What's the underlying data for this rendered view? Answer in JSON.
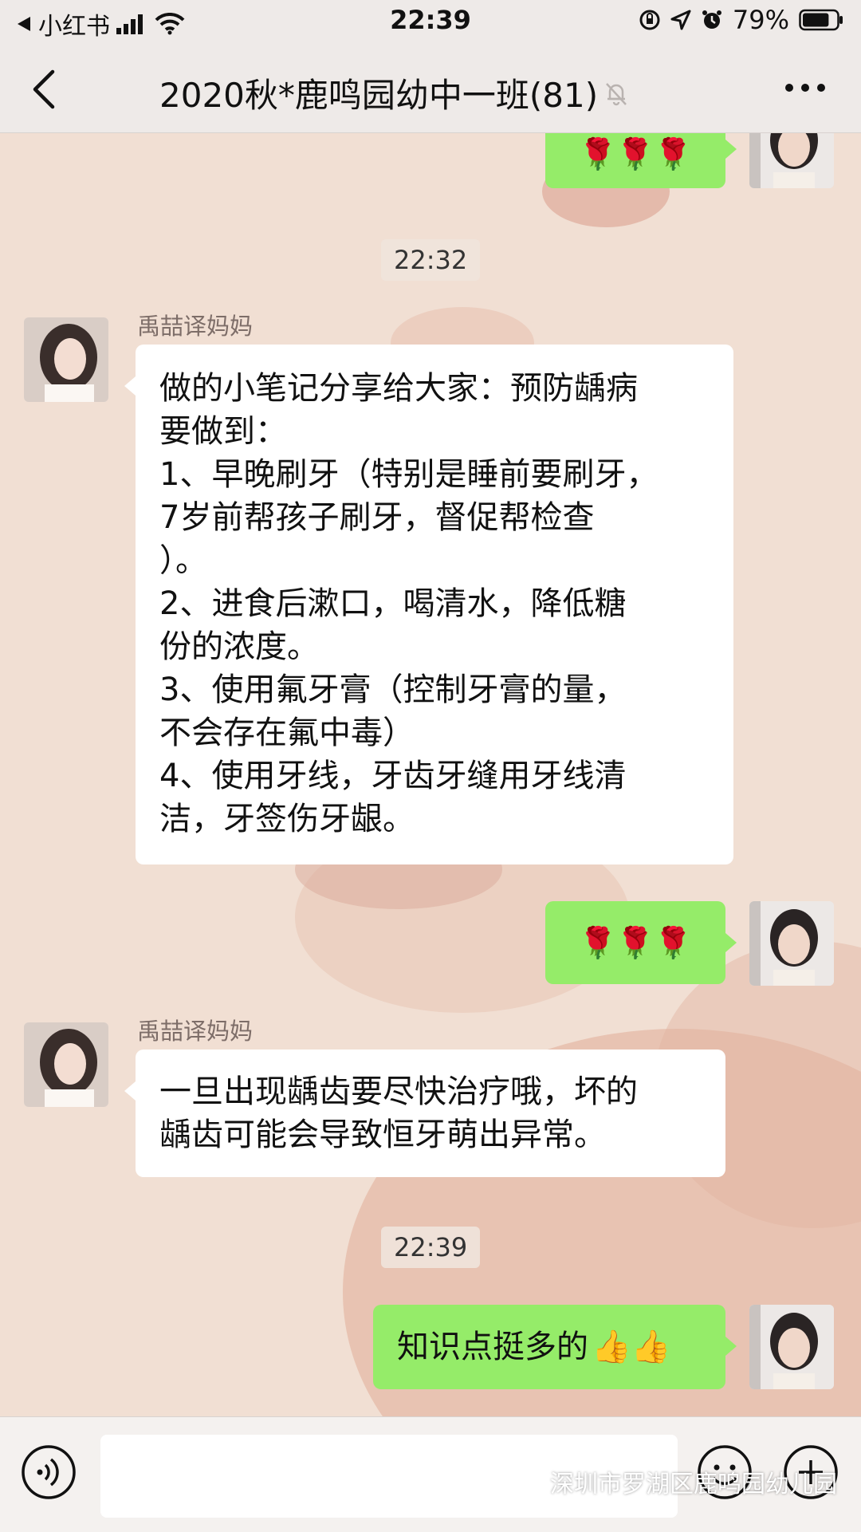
{
  "status_bar": {
    "back_app": "小红书",
    "time": "22:39",
    "battery": "79%",
    "battery_level": 0.79
  },
  "nav": {
    "title": "2020秋*鹿鸣园幼中一班(81)"
  },
  "messages": [
    {
      "id": "m0",
      "side": "right",
      "content": "🌹🌹🌹"
    },
    {
      "id": "t1",
      "type": "time",
      "text": "22:32"
    },
    {
      "id": "m1",
      "side": "left",
      "sender": "禹喆译妈妈",
      "lines": [
        "做的小笔记分享给大家：预防龋病",
        "要做到：",
        "1、早晚刷牙（特别是睡前要刷牙，",
        "7岁前帮孩子刷牙，督促帮检查",
        "）。",
        "2、进食后漱口，喝清水，降低糖",
        "份的浓度。",
        "3、使用氟牙膏（控制牙膏的量，",
        "不会存在氟中毒）",
        "4、使用牙线，牙齿牙缝用牙线清",
        "洁，牙签伤牙龈。"
      ]
    },
    {
      "id": "m2",
      "side": "right",
      "content": "🌹🌹🌹"
    },
    {
      "id": "m3",
      "side": "left",
      "sender": "禹喆译妈妈",
      "lines": [
        "一旦出现龋齿要尽快治疗哦，坏的",
        "龋齿可能会导致恒牙萌出异常。"
      ]
    },
    {
      "id": "t2",
      "type": "time",
      "text": "22:39"
    },
    {
      "id": "m4",
      "side": "right",
      "text": "知识点挺多的",
      "emoji": "👍👍"
    }
  ],
  "watermark": "深圳市罗湖区鹿鸣园幼儿园",
  "colors": {
    "bubble_green": "#95ec69",
    "bubble_white": "#ffffff",
    "background": "#f1dfd3",
    "bar": "#eeeae8"
  }
}
